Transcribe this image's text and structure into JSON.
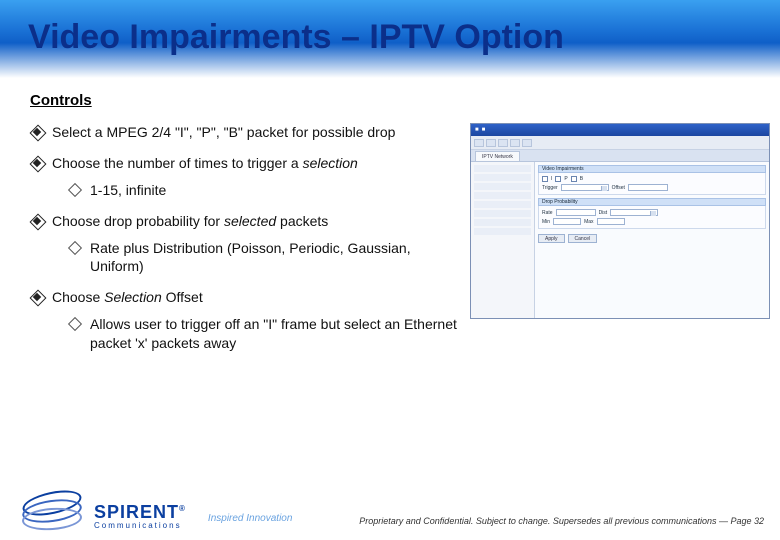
{
  "title": "Video Impairments – IPTV Option",
  "section_heading": "Controls",
  "bullets": [
    {
      "text": "Select a MPEG 2/4 \"I\", \"P\", \"B\" packet for possible drop"
    },
    {
      "text": "Choose the number of times to trigger a ",
      "italic_suffix": "selection",
      "sub": [
        {
          "text": "1-15, infinite"
        }
      ]
    },
    {
      "text": "Choose drop probability for ",
      "italic_mid": "selected",
      "after": " packets",
      "sub": [
        {
          "text": "Rate plus Distribution (Poisson, Periodic, Gaussian, Uniform)"
        }
      ]
    },
    {
      "text": "Choose ",
      "italic_mid": "Selection",
      "after": " Offset",
      "sub": [
        {
          "text": "Allows user to trigger off an \"I\" frame but select an Ethernet packet 'x' packets away"
        }
      ]
    }
  ],
  "thumb": {
    "tab_label": "IPTV Network",
    "panel1": "Video Impairments",
    "panel2": "Drop Probability",
    "btn_apply": "Apply",
    "btn_cancel": "Cancel"
  },
  "logo": {
    "name": "SPIRENT",
    "reg": "®",
    "sub": "Communications",
    "tagline": "Inspired Innovation"
  },
  "footer_note": "Proprietary and Confidential.  Subject to change.  Supersedes all previous communications — Page 32"
}
